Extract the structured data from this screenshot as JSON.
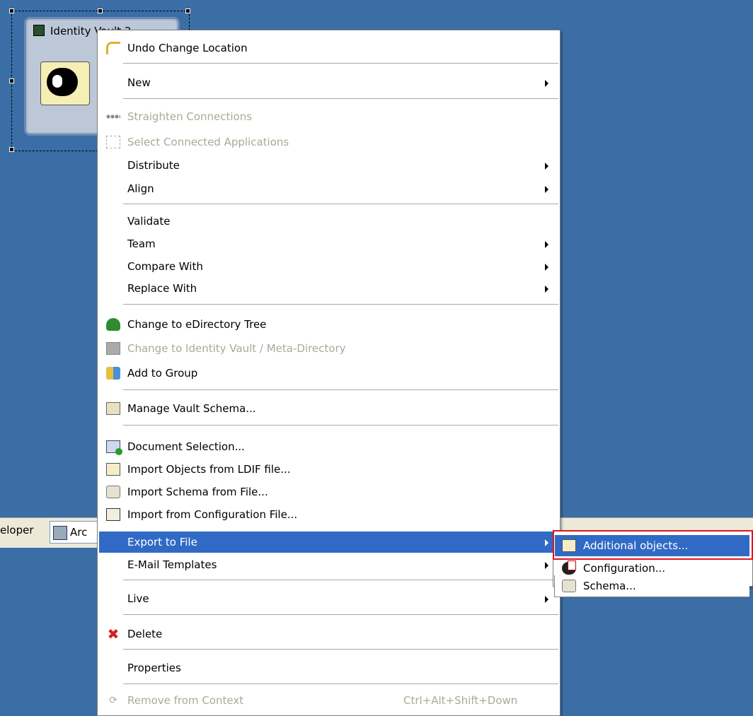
{
  "canvas": {
    "node_title": "Identity Vault 2"
  },
  "tabbar": {
    "developer_label": "eloper",
    "arch_label": "Arc"
  },
  "context_menu": {
    "items": [
      {
        "label": "Undo Change Location",
        "icon": "undo-icon",
        "enabled": true
      },
      {
        "label": "New",
        "submenu": true,
        "enabled": true
      },
      {
        "label": "Straighten Connections",
        "icon": "straighten-icon",
        "enabled": false
      },
      {
        "label": "Select Connected Applications",
        "icon": "select-connected-icon",
        "enabled": false
      },
      {
        "label": "Distribute",
        "submenu": true,
        "enabled": true
      },
      {
        "label": "Align",
        "submenu": true,
        "enabled": true
      },
      {
        "label": "Validate",
        "enabled": true
      },
      {
        "label": "Team",
        "submenu": true,
        "enabled": true
      },
      {
        "label": "Compare With",
        "submenu": true,
        "enabled": true
      },
      {
        "label": "Replace With",
        "submenu": true,
        "enabled": true
      },
      {
        "label": "Change to eDirectory Tree",
        "icon": "tree-icon",
        "enabled": true
      },
      {
        "label": "Change to Identity Vault / Meta-Directory",
        "icon": "vault-icon",
        "enabled": false
      },
      {
        "label": "Add to Group",
        "icon": "group-icon",
        "enabled": true
      },
      {
        "label": "Manage Vault Schema...",
        "icon": "schema-icon",
        "enabled": true
      },
      {
        "label": "Document Selection...",
        "icon": "document-icon",
        "enabled": true
      },
      {
        "label": "Import Objects from LDIF file...",
        "icon": "ldif-icon",
        "enabled": true
      },
      {
        "label": "Import Schema from File...",
        "icon": "import-schema-icon",
        "enabled": true
      },
      {
        "label": "Import from Configuration File...",
        "icon": "config-file-icon",
        "enabled": true
      },
      {
        "label": "Export to File",
        "submenu": true,
        "enabled": true,
        "highlighted": true
      },
      {
        "label": "E-Mail Templates",
        "submenu": true,
        "enabled": true
      },
      {
        "label": "Live",
        "submenu": true,
        "enabled": true
      },
      {
        "label": "Delete",
        "icon": "delete-icon",
        "enabled": true
      },
      {
        "label": "Properties",
        "enabled": true
      },
      {
        "label": "Remove from Context",
        "icon": "remove-icon",
        "shortcut": "Ctrl+Alt+Shift+Down",
        "enabled": false
      }
    ]
  },
  "submenu": {
    "items": [
      {
        "label": "Additional objects...",
        "icon": "ldif-icon",
        "highlighted": true
      },
      {
        "label": "Configuration...",
        "icon": "configuration-icon"
      },
      {
        "label": "Schema...",
        "icon": "schema-icon"
      }
    ]
  },
  "colors": {
    "background": "#3a6ea5",
    "menu_highlight": "#316ac5",
    "annotation_box": "#e0141e",
    "disabled_text": "#aca899"
  }
}
